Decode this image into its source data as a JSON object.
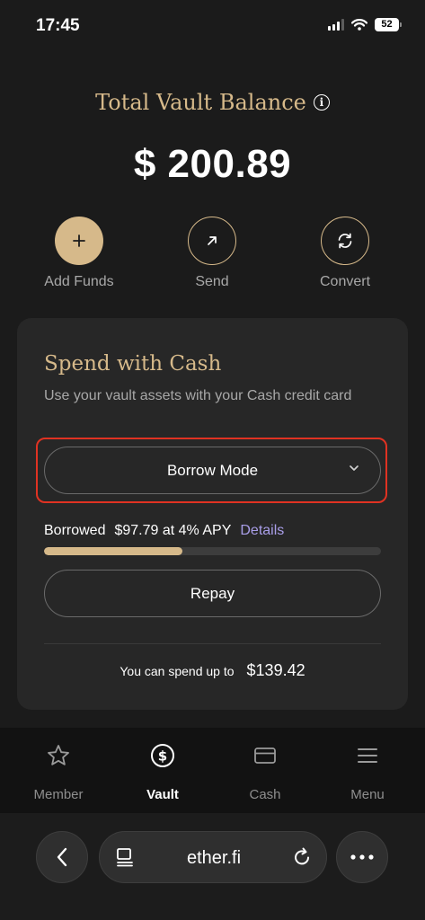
{
  "status_bar": {
    "time": "17:45",
    "battery": "52"
  },
  "vault": {
    "title": "Total Vault Balance",
    "balance": "$ 200.89"
  },
  "actions": [
    {
      "label": "Add Funds",
      "icon": "plus-icon"
    },
    {
      "label": "Send",
      "icon": "arrow-up-right-icon"
    },
    {
      "label": "Convert",
      "icon": "convert-icon"
    }
  ],
  "spend_card": {
    "title": "Spend with Cash",
    "description": "Use your vault assets with your Cash credit card",
    "mode_label": "Borrow Mode",
    "borrowed_label": "Borrowed",
    "borrowed_value": "$97.79 at 4% APY",
    "details_link": "Details",
    "borrow_progress_fraction": 0.41,
    "repay_label": "Repay",
    "spend_label": "You can spend up to",
    "spend_value": "$139.42"
  },
  "tabs": [
    {
      "label": "Member",
      "icon": "star-icon",
      "active": false
    },
    {
      "label": "Vault",
      "icon": "dollar-circle-icon",
      "active": true
    },
    {
      "label": "Cash",
      "icon": "card-icon",
      "active": false
    },
    {
      "label": "Menu",
      "icon": "menu-icon",
      "active": false
    }
  ],
  "browser": {
    "url": "ether.fi"
  },
  "colors": {
    "accent_gold": "#d6b98a",
    "link_purple": "#a99ee8",
    "highlight_red": "#e03222",
    "background": "#1b1b1b",
    "card": "#272727"
  }
}
